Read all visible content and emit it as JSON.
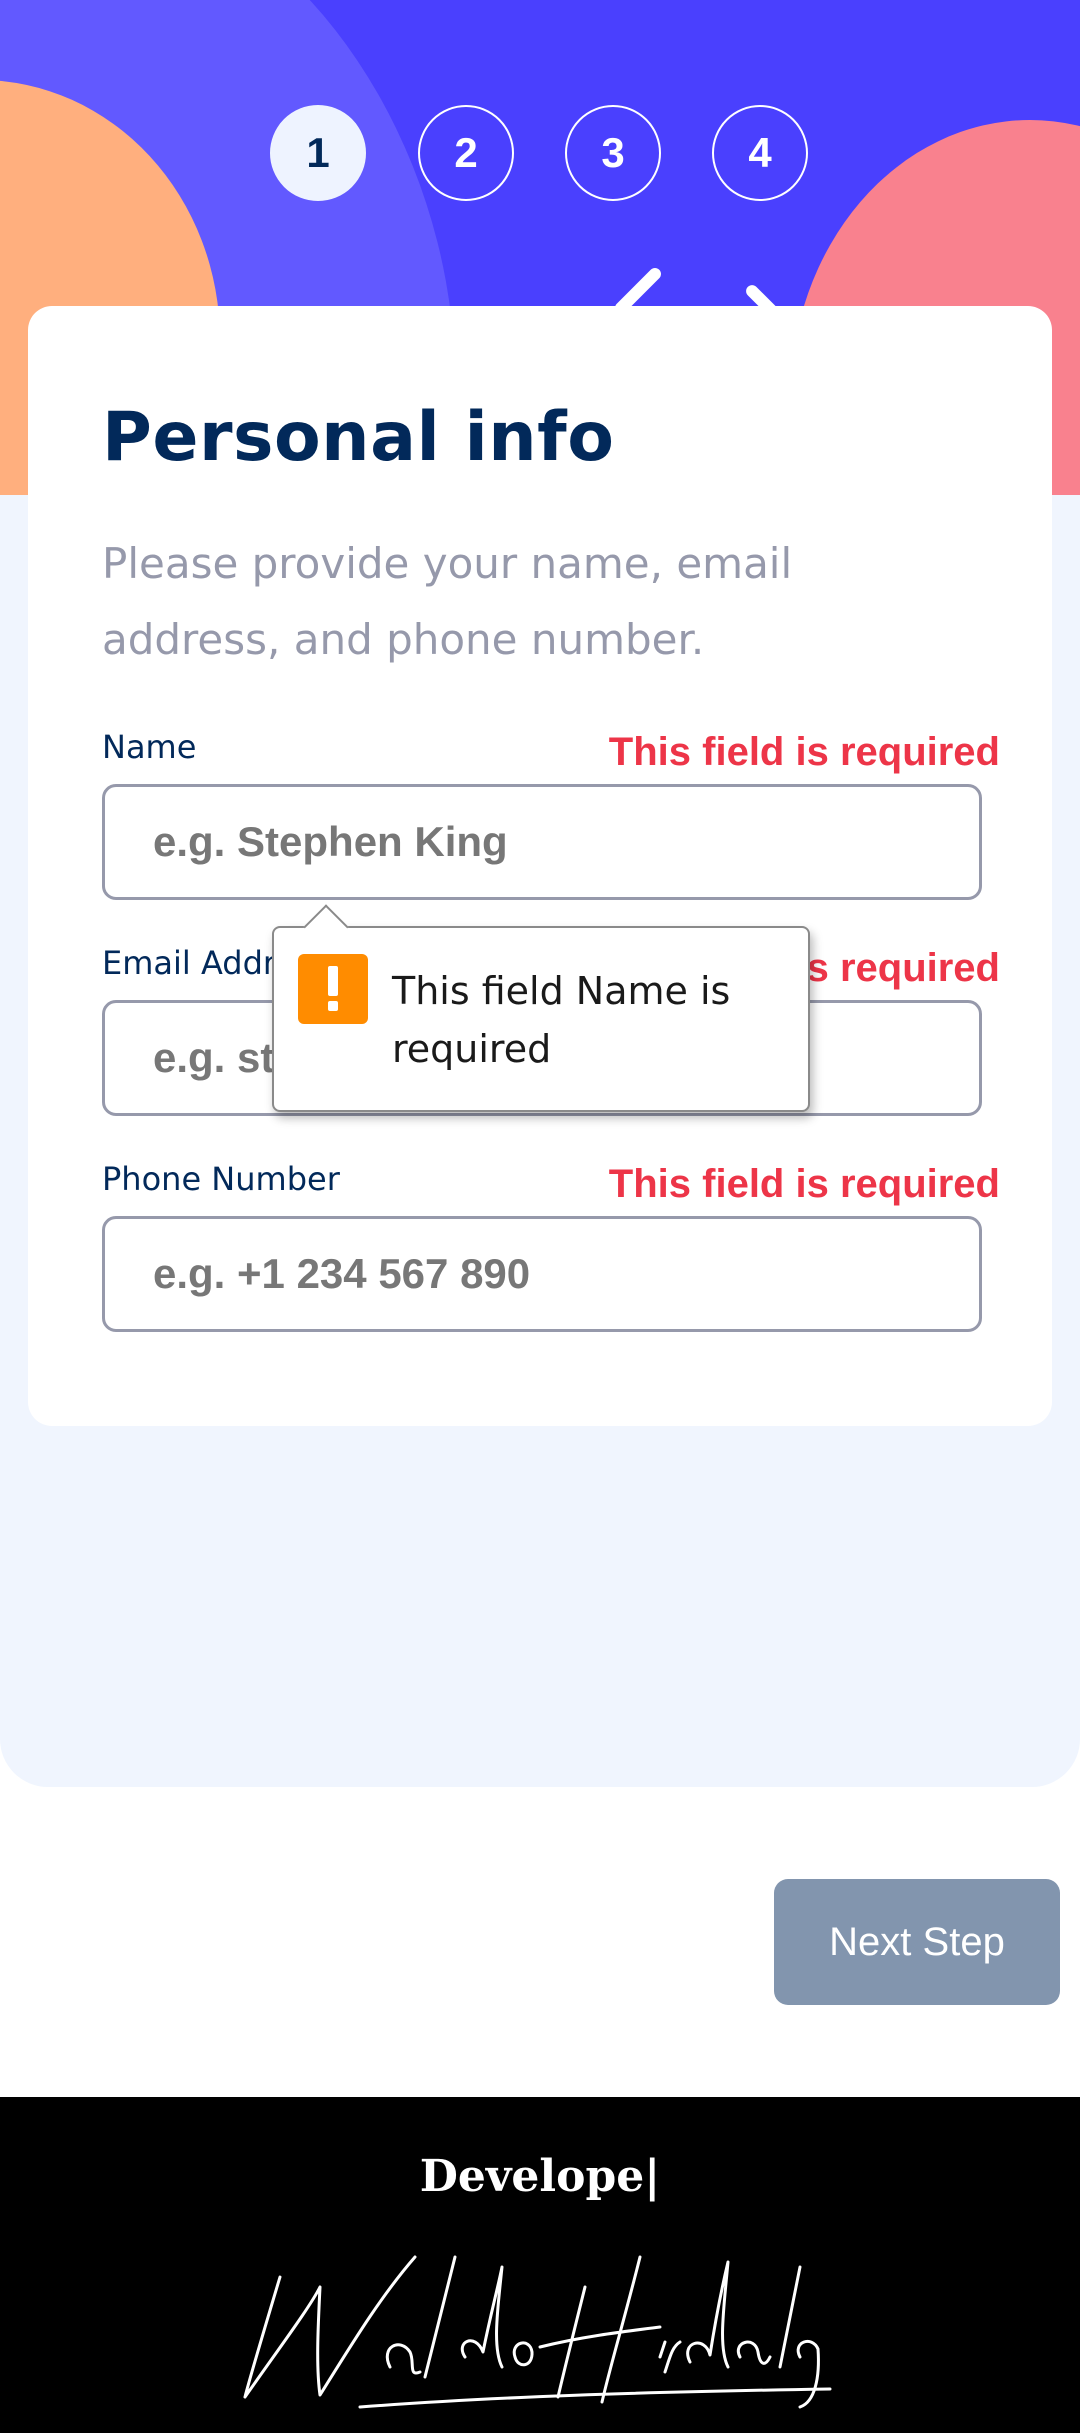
{
  "steps": [
    "1",
    "2",
    "3",
    "4"
  ],
  "active_step": "1",
  "form": {
    "title": "Personal info",
    "subtitle": "Please provide your name, email address, and phone number.",
    "fields": [
      {
        "label": "Name",
        "error": "This field is required",
        "placeholder": "e.g. Stephen King"
      },
      {
        "label": "Email Address",
        "error": "This field is required",
        "placeholder": "e.g. stephenking@lorem.com"
      },
      {
        "label": "Phone Number",
        "error": "This field is required",
        "placeholder": "e.g. +1 234 567 890"
      }
    ]
  },
  "tooltip": {
    "message": "This field Name is required",
    "icon": "warning-icon"
  },
  "next_button": {
    "label": "Next Step"
  },
  "footer": {
    "text": "Develope|",
    "signature": "Waldo Hidalgo."
  },
  "colors": {
    "header_bg": "#4a40fe",
    "title": "#02295a",
    "error": "#ed3548",
    "button": "#8295ae",
    "active_step_bg": "#eef3ff",
    "warning": "#ff8c00",
    "orange_blob": "#ffaf7e",
    "pink_blob": "#f9818e"
  }
}
